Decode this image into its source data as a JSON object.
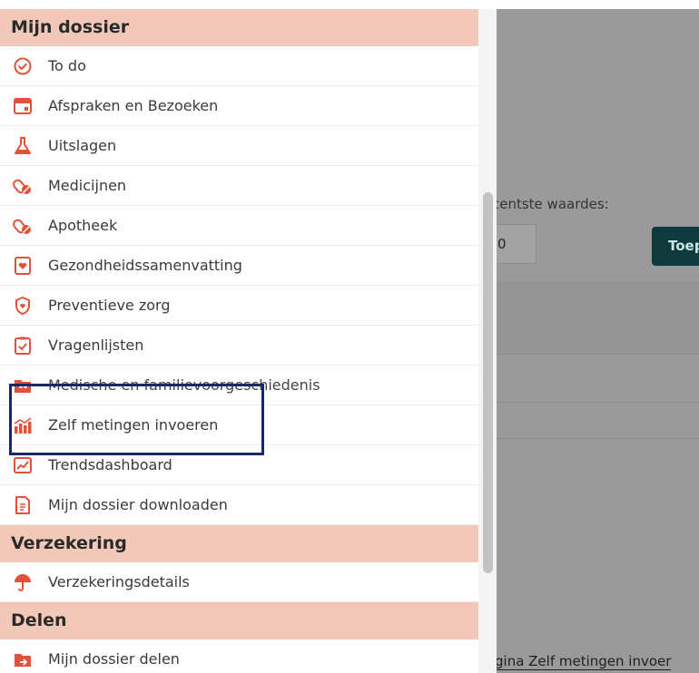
{
  "menu": {
    "sections": [
      {
        "title": "Mijn dossier",
        "items": [
          {
            "label": "To do",
            "icon": "check-circle-icon"
          },
          {
            "label": "Afspraken en Bezoeken",
            "icon": "calendar-icon"
          },
          {
            "label": "Uitslagen",
            "icon": "flask-icon"
          },
          {
            "label": "Medicijnen",
            "icon": "pills-icon"
          },
          {
            "label": "Apotheek",
            "icon": "pills-icon"
          },
          {
            "label": "Gezondheidssamenvatting",
            "icon": "summary-heart-icon"
          },
          {
            "label": "Preventieve zorg",
            "icon": "shield-heart-icon"
          },
          {
            "label": "Vragenlijsten",
            "icon": "clipboard-check-icon"
          },
          {
            "label": "Medische en familievoorgeschiedenis",
            "icon": "folder-family-icon"
          },
          {
            "label": "Zelf metingen invoeren",
            "icon": "bar-chart-icon"
          },
          {
            "label": "Trendsdashboard",
            "icon": "trend-chart-icon"
          },
          {
            "label": "Mijn dossier downloaden",
            "icon": "document-download-icon"
          }
        ]
      },
      {
        "title": "Verzekering",
        "items": [
          {
            "label": "Verzekeringsdetails",
            "icon": "umbrella-icon"
          }
        ]
      },
      {
        "title": "Delen",
        "items": [
          {
            "label": "Mijn dossier delen",
            "icon": "folder-share-icon"
          }
        ]
      }
    ]
  },
  "background": {
    "label": "centste waardes:",
    "input_value": "0",
    "button_label": "Toep",
    "footer_link": "gina Zelf metingen invoer"
  },
  "colors": {
    "section_header_bg": "#f2c9b8",
    "icon_accent": "#e2513a",
    "focus_outline": "#15296b",
    "backdrop": "#9a9a9a",
    "button_bg": "#0d3a3c"
  }
}
